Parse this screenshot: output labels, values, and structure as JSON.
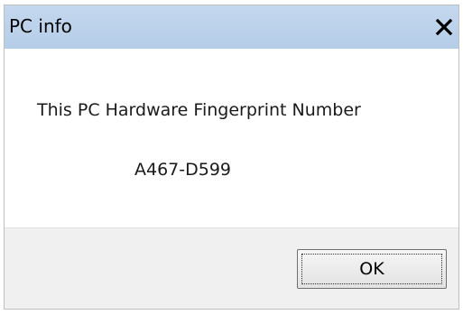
{
  "window": {
    "title": "PC info",
    "close_icon": "close-x-icon"
  },
  "content": {
    "message": "This PC Hardware Fingerprint Number",
    "fingerprint": "A467-D599"
  },
  "footer": {
    "ok_label": "OK"
  },
  "colors": {
    "titlebar": "#b9d1ea",
    "footer": "#f0f0f0",
    "window_border": "#bfbfbf"
  }
}
